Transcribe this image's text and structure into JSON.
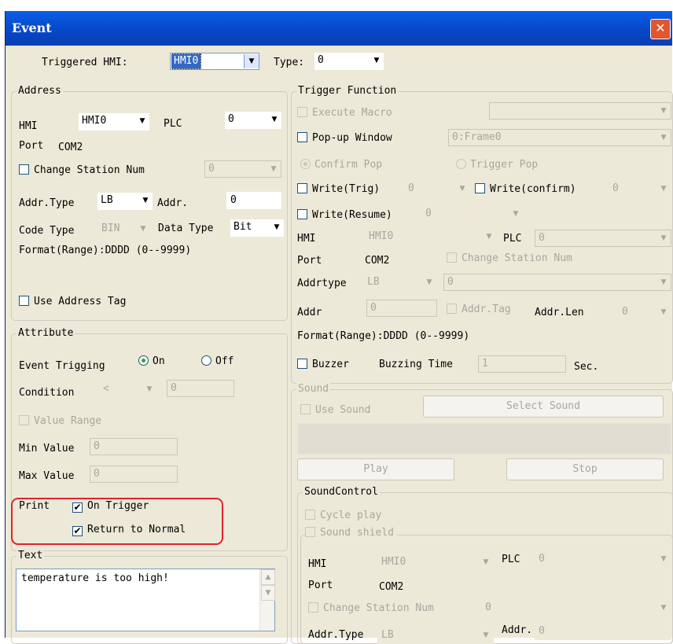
{
  "window": {
    "title": "Event"
  },
  "top": {
    "triggered_hmi_label": "Triggered HMI:",
    "triggered_hmi_value": "HMI0",
    "type_label": "Type:",
    "type_value": "0"
  },
  "address": {
    "title": "Address",
    "hmi_label": "HMI",
    "hmi_value": "HMI0",
    "plc_label": "PLC",
    "plc_value": "0",
    "port_label": "Port",
    "port_value": "COM2",
    "change_station_label": "Change Station Num",
    "change_station_value": "0",
    "addr_type_label": "Addr.Type",
    "addr_type_value": "LB",
    "addr_label": "Addr.",
    "addr_value": "0",
    "code_type_label": "Code Type",
    "code_type_value": "BIN",
    "data_type_label": "Data Type",
    "data_type_value": "Bit",
    "format_text": "Format(Range):DDDD (0--9999)",
    "use_tag_label": "Use Address Tag"
  },
  "attribute": {
    "title": "Attribute",
    "event_trig_label": "Event Trigging",
    "on_label": "On",
    "off_label": "Off",
    "condition_label": "Condition",
    "condition_op": "<",
    "condition_value": "0",
    "value_range_label": "Value Range",
    "min_label": "Min Value",
    "min_value": "0",
    "max_label": "Max Value",
    "max_value": "0",
    "print_label": "Print",
    "on_trigger_label": "On Trigger",
    "return_normal_label": "Return to Normal"
  },
  "text_group": {
    "title": "Text",
    "content": "temperature is too high!"
  },
  "trigger": {
    "title": "Trigger Function",
    "execute_macro_label": "Execute Macro",
    "popup_label": "Pop-up Window",
    "popup_value": "0:Frame0",
    "confirm_pop_label": "Confirm Pop",
    "trigger_pop_label": "Trigger Pop",
    "write_trig_label": "Write(Trig)",
    "write_trig_value": "0",
    "write_confirm_label": "Write(confirm)",
    "write_confirm_value": "0",
    "write_resume_label": "Write(Resume)",
    "write_resume_value": "0",
    "hmi_label": "HMI",
    "hmi_value": "HMI0",
    "plc_label": "PLC",
    "plc_value": "0",
    "port_label": "Port",
    "port_value": "COM2",
    "change_station_label": "Change Station Num",
    "addrtype_label": "Addrtype",
    "addrtype_value": "LB",
    "addrtype_value2": "0",
    "addr_label": "Addr",
    "addr_value": "0",
    "addr_tag_label": "Addr.Tag",
    "addr_len_label": "Addr.Len",
    "addr_len_value": "0",
    "format_text": "Format(Range):DDDD (0--9999)",
    "buzzer_label": "Buzzer",
    "buzzing_time_label": "Buzzing Time",
    "buzzing_time_value": "1",
    "sec_label": "Sec."
  },
  "sound": {
    "title": "Sound",
    "use_sound_label": "Use Sound",
    "select_sound_label": "Select Sound",
    "play_label": "Play",
    "stop_label": "Stop",
    "control_title": "SoundControl",
    "cycle_play_label": "Cycle play",
    "sound_shield_label": "Sound shield",
    "hmi_label": "HMI",
    "hmi_value": "HMI0",
    "plc_label": "PLC",
    "plc_value": "0",
    "port_label": "Port",
    "port_value": "COM2",
    "change_station_label": "Change Station Num",
    "change_station_value": "0",
    "addr_type_label": "Addr.Type",
    "addr_type_value": "LB",
    "addr_label": "Addr.",
    "addr_value": "0"
  }
}
